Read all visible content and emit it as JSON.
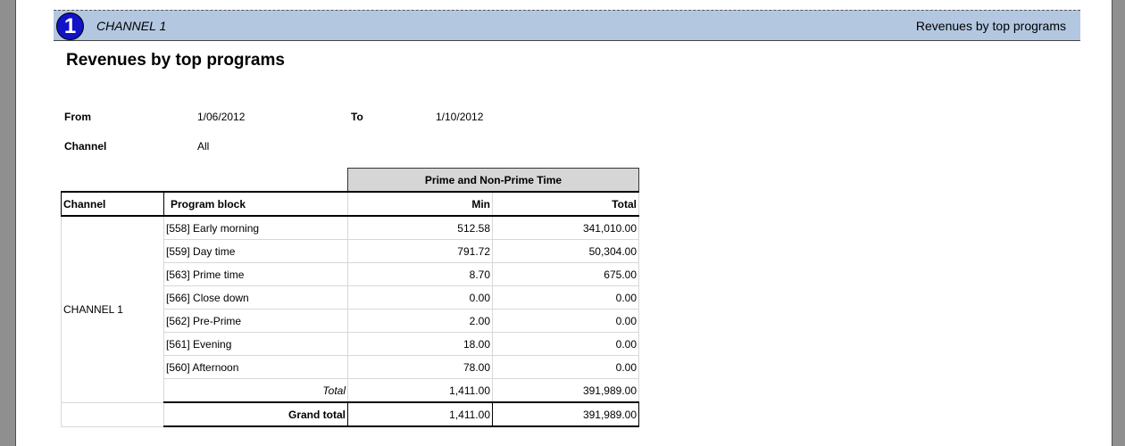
{
  "banner": {
    "badge_number": "1",
    "channel": "CHANNEL 1",
    "report_name": "Revenues by top programs"
  },
  "report": {
    "title": "Revenues by top programs"
  },
  "params": {
    "from_label": "From",
    "from_value": "1/06/2012",
    "to_label": "To",
    "to_value": "1/10/2012",
    "channel_label": "Channel",
    "channel_value": "All"
  },
  "table": {
    "group_header": "Prime and Non-Prime Time",
    "columns": {
      "channel": "Channel",
      "program_block": "Program block",
      "min": "Min",
      "total": "Total"
    },
    "channel_name": "CHANNEL 1",
    "rows": [
      {
        "program": "[558] Early morning",
        "min": "512.58",
        "total": "341,010.00"
      },
      {
        "program": "[559] Day time",
        "min": "791.72",
        "total": "50,304.00"
      },
      {
        "program": "[563] Prime time",
        "min": "8.70",
        "total": "675.00"
      },
      {
        "program": "[566] Close down",
        "min": "0.00",
        "total": "0.00"
      },
      {
        "program": "[562] Pre-Prime",
        "min": "2.00",
        "total": "0.00"
      },
      {
        "program": "[561] Evening",
        "min": "18.00",
        "total": "0.00"
      },
      {
        "program": "[560] Afternoon",
        "min": "78.00",
        "total": "0.00"
      }
    ],
    "subtotal": {
      "label": "Total",
      "min": "1,411.00",
      "total": "391,989.00"
    },
    "grand_total": {
      "label": "Grand total",
      "min": "1,411.00",
      "total": "391,989.00"
    }
  },
  "colors": {
    "banner_bg": "#b3c7e1",
    "badge_bg": "#1212c8",
    "group_header_bg": "#d6d6d6",
    "viewer_bg": "#8f8f8f"
  }
}
